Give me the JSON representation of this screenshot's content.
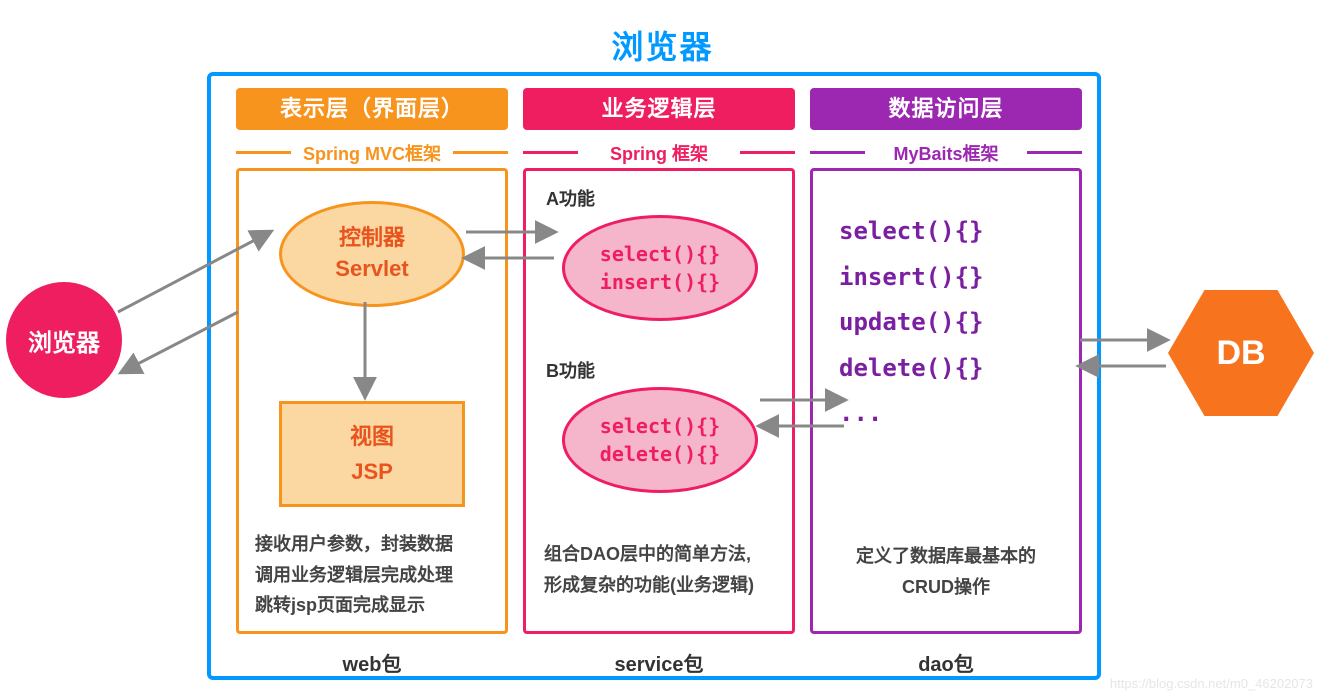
{
  "title": "浏览器",
  "outer_browser_label": "浏览器",
  "db_label": "DB",
  "watermark": "https://blog.csdn.net/m0_46202073",
  "columns": {
    "pres": {
      "title": "表示层（界面层）",
      "sub": "Spring MVC框架",
      "foot": "web包",
      "controller": {
        "line1": "控制器",
        "line2": "Servlet"
      },
      "view": {
        "line1": "视图",
        "line2": "JSP"
      },
      "desc_l1": "接收用户参数，封装数据",
      "desc_l2": "调用业务逻辑层完成处理",
      "desc_l3": "跳转jsp页面完成显示"
    },
    "biz": {
      "title": "业务逻辑层",
      "sub": "Spring 框架",
      "foot": "service包",
      "funcA_label": "A功能",
      "funcA_m1": "select(){}",
      "funcA_m2": "insert(){}",
      "funcB_label": "B功能",
      "funcB_m1": "select(){}",
      "funcB_m2": "delete(){}",
      "desc_l1": "组合DAO层中的简单方法,",
      "desc_l2": "形成复杂的功能(业务逻辑)"
    },
    "dao": {
      "title": "数据访问层",
      "sub": "MyBaits框架",
      "foot": "dao包",
      "m1": "select(){}",
      "m2": "insert(){}",
      "m3": "update(){}",
      "m4": "delete(){}",
      "m5": "...",
      "desc_l1": "定义了数据库最基本的",
      "desc_l2": "CRUD操作"
    }
  }
}
